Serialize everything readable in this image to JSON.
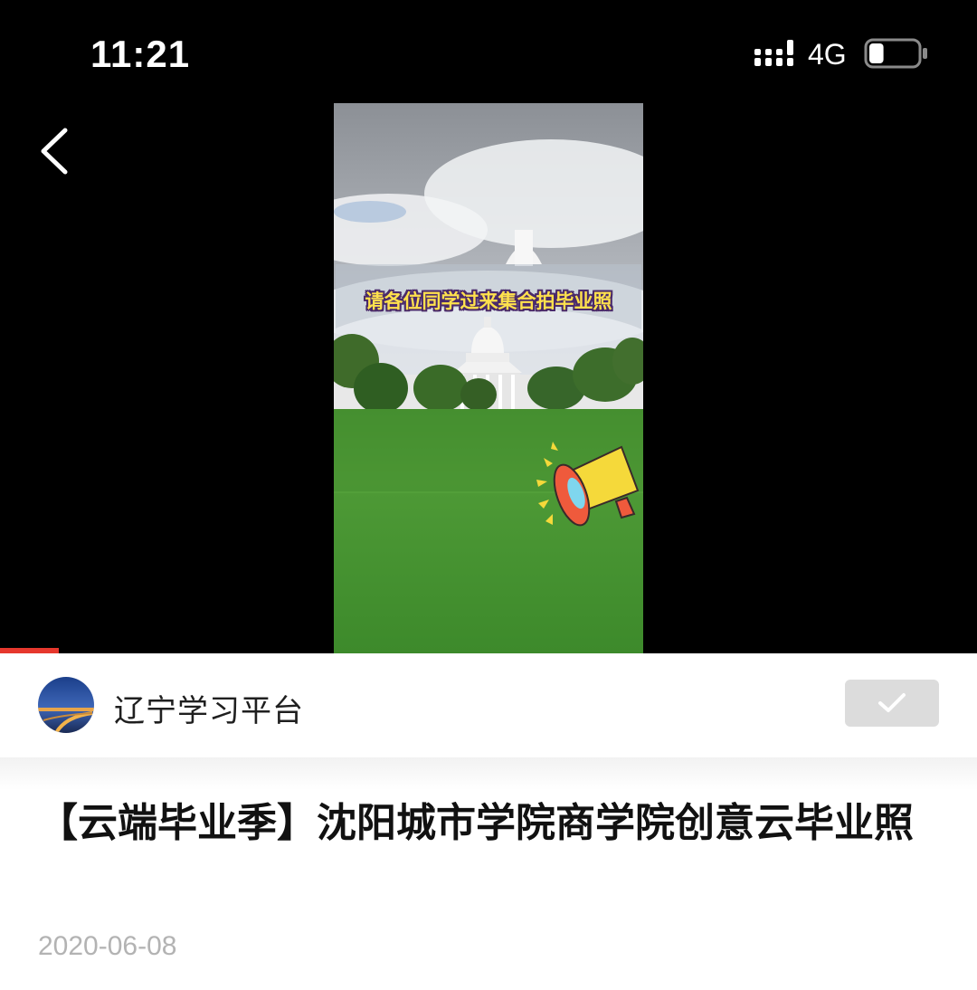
{
  "status_bar": {
    "time": "11:21",
    "network": "4G",
    "battery_level": 0.3
  },
  "navigation": {
    "back_icon": "chevron-left-icon"
  },
  "video": {
    "caption": "请各位同学过来集合拍毕业照",
    "progress": 0.06,
    "colors": {
      "progress": "#e6372d"
    }
  },
  "account": {
    "name": "辽宁学习平台",
    "follow_icon": "checkmark-icon"
  },
  "article": {
    "title": "【云端毕业季】沈阳城市学院商学院创意云毕业照",
    "date": "2020-06-08"
  }
}
